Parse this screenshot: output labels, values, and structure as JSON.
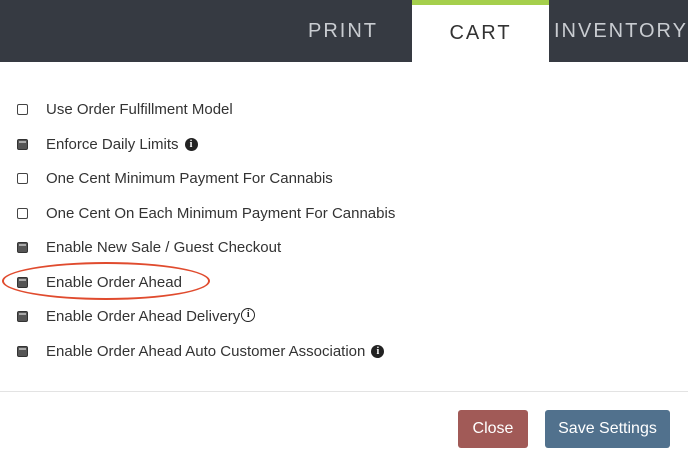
{
  "tabs": {
    "print": "PRINT",
    "cart": "CART",
    "inventory": "INVENTORY"
  },
  "options": [
    {
      "label": "Use Order Fulfillment Model",
      "checked": false,
      "info": false
    },
    {
      "label": "Enforce Daily Limits",
      "checked": true,
      "info": true
    },
    {
      "label": "One Cent Minimum Payment For Cannabis",
      "checked": false,
      "info": false
    },
    {
      "label": "One Cent On Each Minimum Payment For Cannabis",
      "checked": false,
      "info": false
    },
    {
      "label": "Enable New Sale / Guest Checkout",
      "checked": true,
      "info": false
    },
    {
      "label": "Enable Order Ahead",
      "checked": true,
      "info": false
    },
    {
      "label": "Enable Order Ahead Delivery",
      "checked": true,
      "info": true
    },
    {
      "label": "Enable Order Ahead Auto Customer Association",
      "checked": true,
      "info": true
    }
  ],
  "info_icon_glyph": "i",
  "buttons": {
    "close": "Close",
    "save": "Save Settings"
  },
  "colors": {
    "topbar": "#363a42",
    "active_tab_accent": "#a5cf4c",
    "highlight_ring": "#e04b2e",
    "close_button": "#a15a57",
    "save_button": "#51718d"
  }
}
